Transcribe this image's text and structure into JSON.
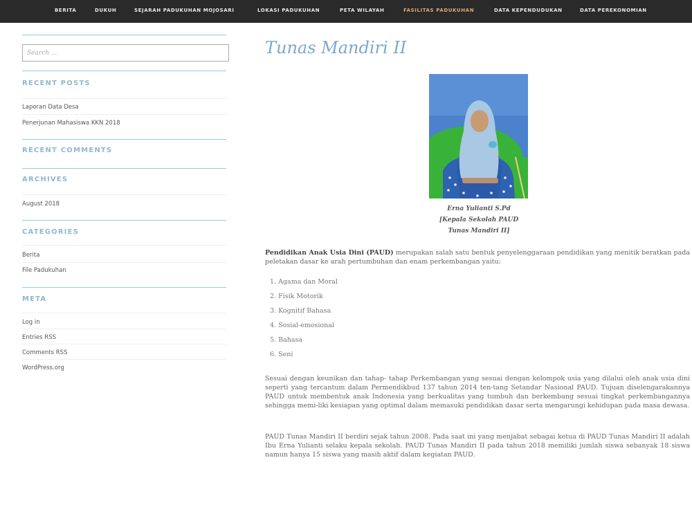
{
  "nav": {
    "items": [
      {
        "label": "BERITA"
      },
      {
        "label": "DUKUH"
      },
      {
        "label": "SEJARAH PADUKUHAN MOJOSARI"
      },
      {
        "label": "LOKASI PADUKUHAN"
      },
      {
        "label": "PETA WILAYAH"
      },
      {
        "label": "FASILITAS PADUKUHAN"
      },
      {
        "label": "DATA KEPENDUDUKAN"
      },
      {
        "label": "DATA PEREKONOMIAN"
      }
    ],
    "active_index": 5,
    "active_color": "#d8a878",
    "background": "#2a2a2a"
  },
  "sidebar": {
    "search": {
      "placeholder": "Search ...",
      "value": ""
    },
    "recent_posts": {
      "title": "RECENT POSTS",
      "items": [
        "Laporan Data Desa",
        "Penerjunan Mahasiswa KKN 2018"
      ]
    },
    "recent_comments": {
      "title": "RECENT COMMENTS"
    },
    "archives": {
      "title": "ARCHIVES",
      "items": [
        "August 2018"
      ]
    },
    "categories": {
      "title": "CATEGORIES",
      "items": [
        "Berita",
        "File Padukuhan"
      ]
    },
    "meta": {
      "title": "META",
      "items": [
        "Log in",
        "Entries RSS",
        "Comments RSS",
        "WordPress.org"
      ]
    },
    "accent": "#8fb8d2"
  },
  "post": {
    "title": "Tunas Mandiri II",
    "title_color": "#7aa9c8",
    "caption": {
      "line1": "Erna Yulianti S.Pd",
      "line2": "[Kepala Sekolah PAUD",
      "line3": "Tunas Mandiri II]"
    },
    "intro_bold": "Pendidikan Anak Usia Dini (PAUD)",
    "intro_rest": " merupakan salah satu bentuk penyelenggaraan pendidikan yang menitik beratkan pada peletakan dasar ke arah pertumbuhan dan enam perkembangan yaitu:",
    "list": [
      "Agama dan Moral",
      "Fisik Motorik",
      "Kognitif Bahasa",
      "Sosial-emosional",
      "Bahasa",
      "Seni"
    ],
    "paragraph2": "Sesuai dengan keunikan dan tahap- tahap Perkembangan yang sesuai dengan kelompok usia yang dilalui oleh anak usia dini seperti yang tercantum dalam Permendikbud 137 tahun 2014 ten-tang Setandar Nasional PAUD. Tujuan diselengarakannya PAUD untuk membentuk anak Indonesia yang berkualitas yang tumbuh dan berkembang sesuai tingkat perkembangannya sehingga memi-liki kesiapan yang optimal dalam memasuki pendidikan dasar serta mengarungi kehidupan pada masa dewasa.",
    "paragraph3": "PAUD Tunas Mandiri II berdiri sejak tahun 2008. Pada saat ini yang menjabat sebagai ketua di PAUD Tunas Mandiri II adalah Ibu Erna Yulianti selaku kepala sekolah. PAUD Tunas Mandiri II pada tahun 2018 memiliki jumlah siswa sebanyak 18 siswa namun hanya 15 siswa yang masih aktif dalam kegiatan PAUD."
  }
}
